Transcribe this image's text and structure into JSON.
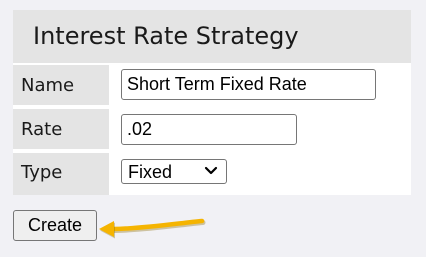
{
  "panel": {
    "title": "Interest Rate Strategy"
  },
  "form": {
    "name": {
      "label": "Name",
      "value": "Short Term Fixed Rate"
    },
    "rate": {
      "label": "Rate",
      "value": ".02"
    },
    "type": {
      "label": "Type",
      "selected": "Fixed"
    }
  },
  "actions": {
    "create_label": "Create"
  },
  "annotation": {
    "arrow_color": "#f5b400",
    "arrow_icon": "arrow-left-icon"
  }
}
